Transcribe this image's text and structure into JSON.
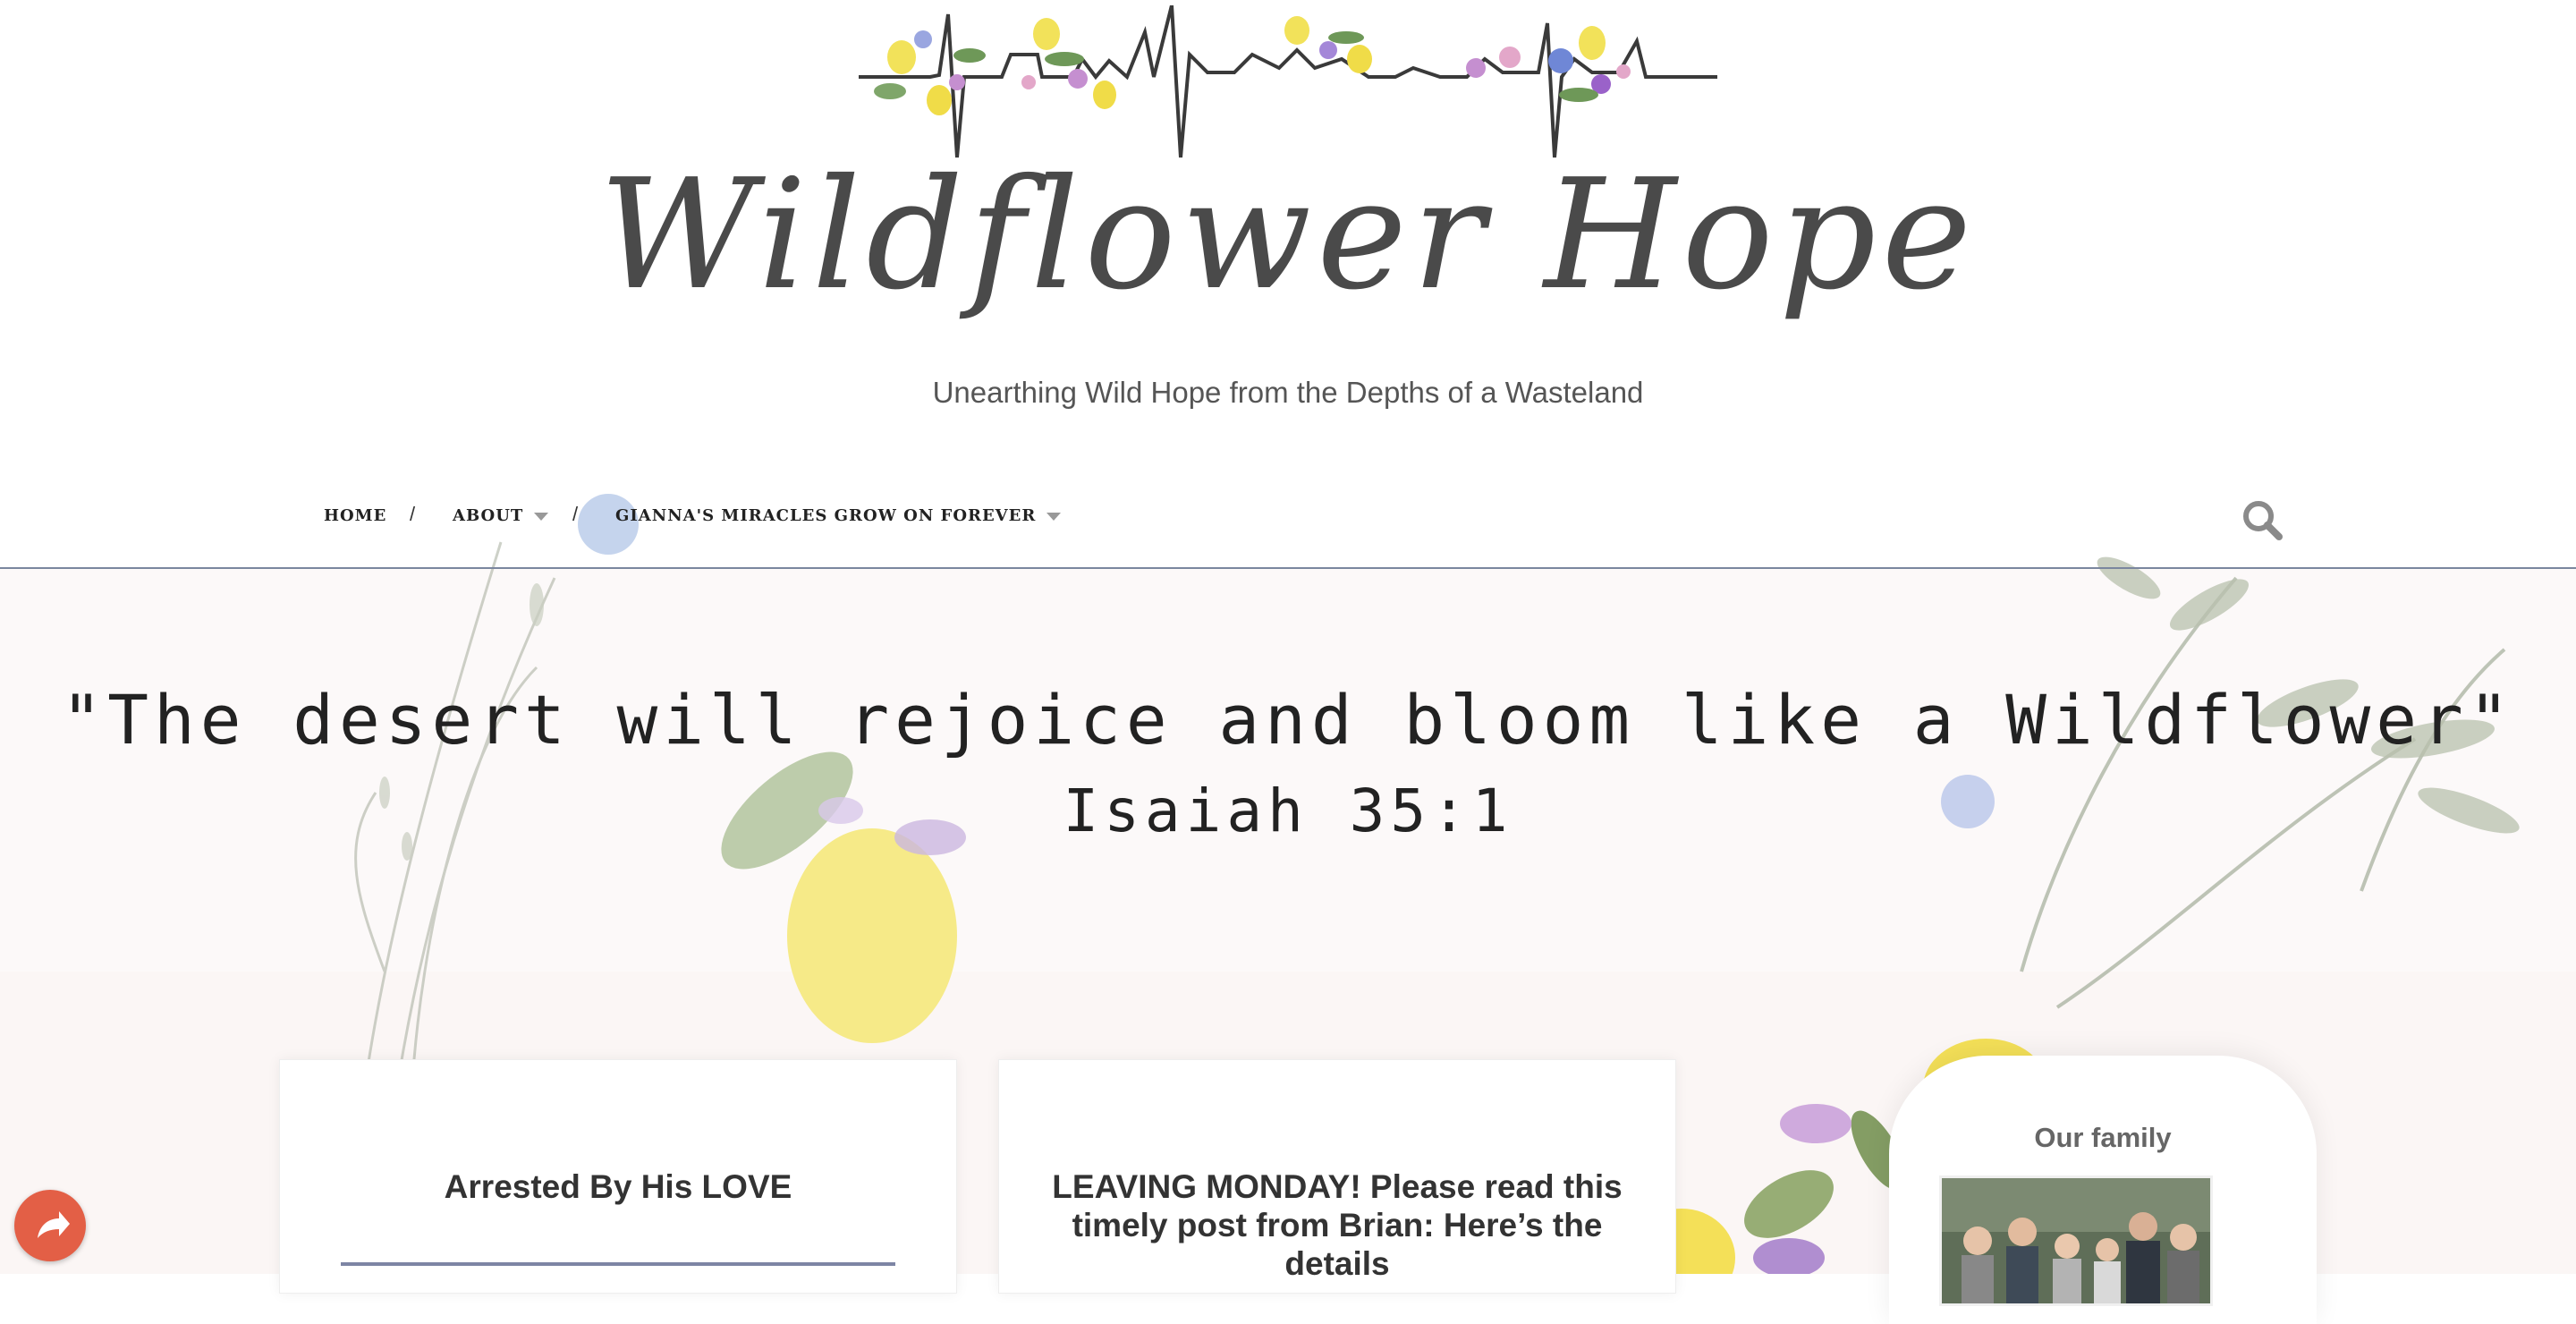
{
  "site": {
    "title": "Wildflower Hope",
    "tagline": "Unearthing Wild Hope from the Depths of a Wasteland"
  },
  "nav": {
    "items": [
      {
        "label": "HOME",
        "has_dropdown": false
      },
      {
        "label": "ABOUT",
        "has_dropdown": true
      },
      {
        "label": "GIANNA'S MIRACLES GROW ON FOREVER",
        "has_dropdown": true
      }
    ],
    "separator": "/",
    "search_icon": "search-icon"
  },
  "hero": {
    "verse": "\"The desert will rejoice and bloom like a Wildflower\"",
    "reference": "Isaiah 35:1"
  },
  "posts": [
    {
      "title": "Arrested By His LOVE"
    },
    {
      "title": "LEAVING MONDAY! Please read this timely post from Brian: Here’s the details"
    }
  ],
  "sidebar": {
    "widget_title": "Our family"
  },
  "share": {
    "icon": "share-icon",
    "color": "#e35f46"
  },
  "colors": {
    "accent_rule": "#7d85a4",
    "nav_border": "#7a869e",
    "hero_bg": "#fcf9f9"
  }
}
